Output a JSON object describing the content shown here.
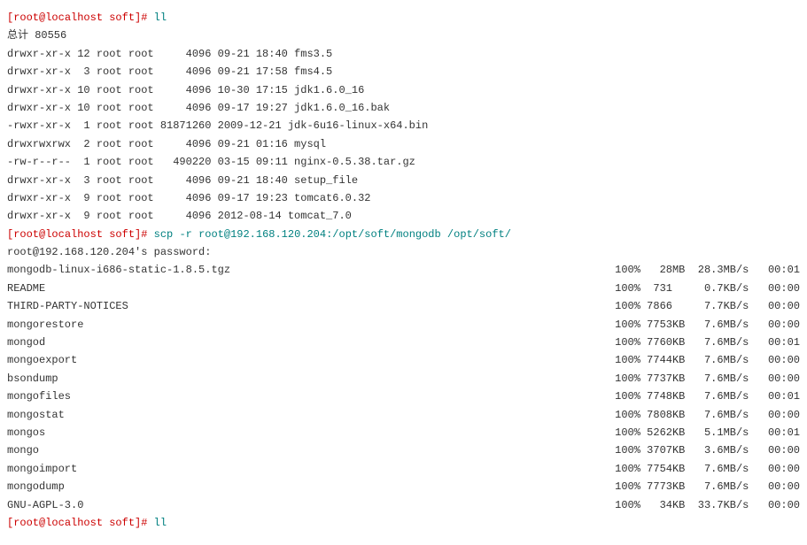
{
  "prompt1": {
    "bl": "[",
    "user": "root",
    "at": "@",
    "host": "localhost",
    "sp": " ",
    "path": "soft",
    "br": "]",
    "hash": "# "
  },
  "cmd1": "ll",
  "total": "总计 80556",
  "ls": [
    {
      "row": "drwxr-xr-x 12 root root     4096 09-21 18:40 fms3.5"
    },
    {
      "row": "drwxr-xr-x  3 root root     4096 09-21 17:58 fms4.5"
    },
    {
      "row": "drwxr-xr-x 10 root root     4096 10-30 17:15 jdk1.6.0_16"
    },
    {
      "row": "drwxr-xr-x 10 root root     4096 09-17 19:27 jdk1.6.0_16.bak"
    },
    {
      "row": "-rwxr-xr-x  1 root root 81871260 2009-12-21 jdk-6u16-linux-x64.bin"
    },
    {
      "row": "drwxrwxrwx  2 root root     4096 09-21 01:16 mysql"
    },
    {
      "row": "-rw-r--r--  1 root root   490220 03-15 09:11 nginx-0.5.38.tar.gz"
    },
    {
      "row": "drwxr-xr-x  3 root root     4096 09-21 18:40 setup_file"
    },
    {
      "row": "drwxr-xr-x  9 root root     4096 09-17 19:23 tomcat6.0.32"
    },
    {
      "row": "drwxr-xr-x  9 root root     4096 2012-08-14 tomcat_7.0"
    }
  ],
  "cmd2": "scp -r root@192.168.120.204:/opt/soft/mongodb /opt/soft/",
  "pw": "root@192.168.120.204's password:",
  "xfer": [
    {
      "name": "mongodb-linux-i686-static-1.8.5.tgz",
      "stats": "100%   28MB  28.3MB/s   00:01"
    },
    {
      "name": "README",
      "stats": "100%  731     0.7KB/s   00:00"
    },
    {
      "name": "THIRD-PARTY-NOTICES",
      "stats": "100% 7866     7.7KB/s   00:00"
    },
    {
      "name": "mongorestore",
      "stats": "100% 7753KB   7.6MB/s   00:00"
    },
    {
      "name": "mongod",
      "stats": "100% 7760KB   7.6MB/s   00:01"
    },
    {
      "name": "mongoexport",
      "stats": "100% 7744KB   7.6MB/s   00:00"
    },
    {
      "name": "bsondump",
      "stats": "100% 7737KB   7.6MB/s   00:00"
    },
    {
      "name": "mongofiles",
      "stats": "100% 7748KB   7.6MB/s   00:01"
    },
    {
      "name": "mongostat",
      "stats": "100% 7808KB   7.6MB/s   00:00"
    },
    {
      "name": "mongos",
      "stats": "100% 5262KB   5.1MB/s   00:01"
    },
    {
      "name": "mongo",
      "stats": "100% 3707KB   3.6MB/s   00:00"
    },
    {
      "name": "mongoimport",
      "stats": "100% 7754KB   7.6MB/s   00:00"
    },
    {
      "name": "mongodump",
      "stats": "100% 7773KB   7.6MB/s   00:00"
    },
    {
      "name": "GNU-AGPL-3.0",
      "stats": "100%   34KB  33.7KB/s   00:00"
    }
  ],
  "cmd3": "ll"
}
